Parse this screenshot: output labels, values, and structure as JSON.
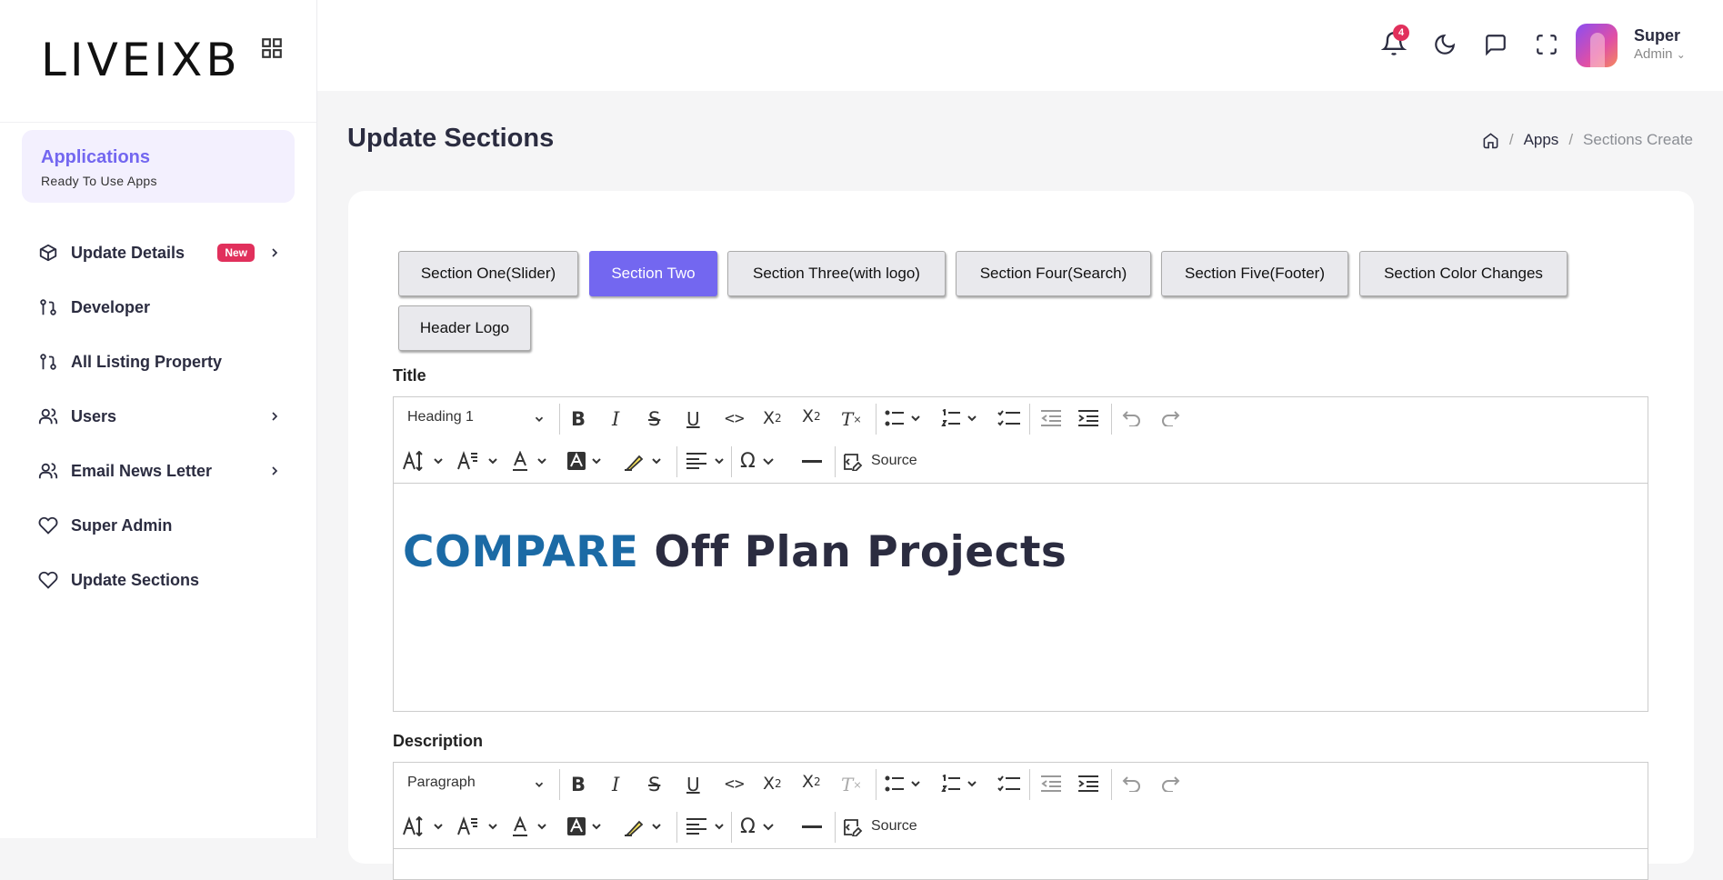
{
  "brand": {
    "logo_text": "LIVEIXB"
  },
  "sidebar": {
    "apps_title": "Applications",
    "apps_subtitle": "Ready To Use Apps",
    "items": [
      {
        "label": "Update Details",
        "badge": "New",
        "icon": "cube-icon",
        "has_submenu": true
      },
      {
        "label": "Developer",
        "icon": "git-pull-icon",
        "has_submenu": false
      },
      {
        "label": "All Listing Property",
        "icon": "git-pull-icon",
        "has_submenu": false
      },
      {
        "label": "Users",
        "icon": "users-icon",
        "has_submenu": true
      },
      {
        "label": "Email News Letter",
        "icon": "users-icon",
        "has_submenu": true
      },
      {
        "label": "Super Admin",
        "icon": "heart-icon",
        "has_submenu": false
      },
      {
        "label": "Update Sections",
        "icon": "heart-icon",
        "has_submenu": false
      }
    ]
  },
  "topbar": {
    "notification_count": "4",
    "user_name": "Super",
    "user_role": "Admin"
  },
  "page": {
    "title": "Update Sections",
    "breadcrumb": {
      "home_icon": "home-icon",
      "apps": "Apps",
      "current": "Sections Create"
    }
  },
  "tabs": [
    {
      "label": "Section One(Slider)",
      "active": false
    },
    {
      "label": "Section Two",
      "active": true
    },
    {
      "label": "Section Three(with logo)",
      "active": false
    },
    {
      "label": "Section Four(Search)",
      "active": false
    },
    {
      "label": "Section Five(Footer)",
      "active": false
    },
    {
      "label": "Section Color Changes",
      "active": false
    },
    {
      "label": "Header Logo",
      "active": false
    }
  ],
  "title_field": {
    "label": "Title",
    "heading_select": "Heading 1",
    "source_label": "Source",
    "content_highlight": "COMPARE",
    "content_rest": " Off Plan Projects"
  },
  "description_field": {
    "label": "Description",
    "heading_select": "Paragraph",
    "source_label": "Source"
  },
  "colors": {
    "accent": "#7367f0",
    "badge": "#e1305c",
    "title_highlight": "#1b6aa5"
  }
}
